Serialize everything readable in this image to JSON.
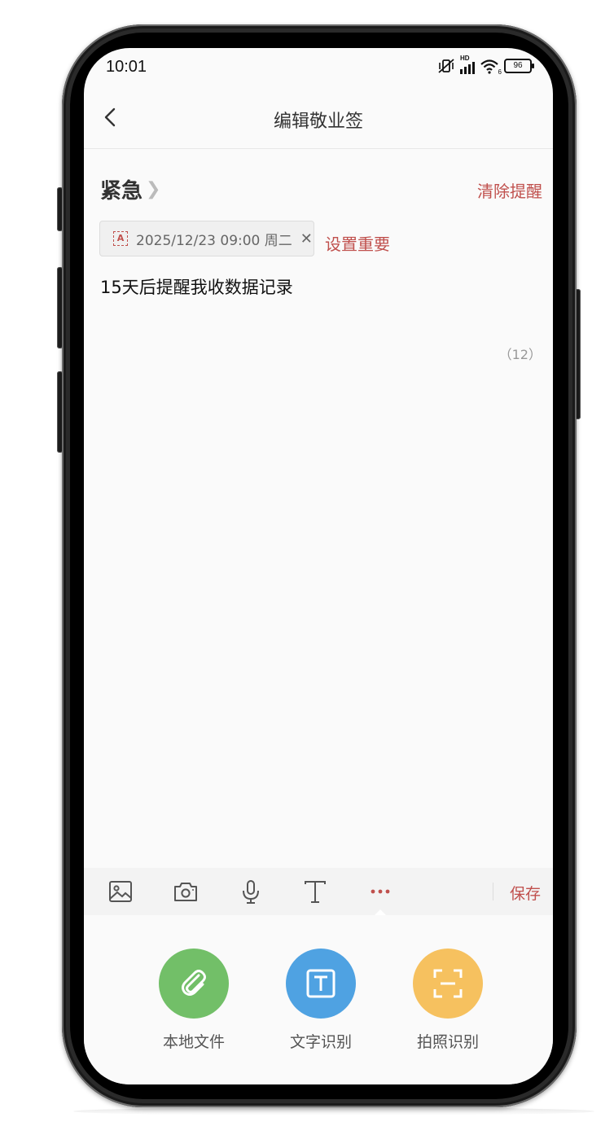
{
  "status_bar": {
    "time": "10:01",
    "network_label": "HD",
    "signal_strength": "6",
    "battery_level": "96"
  },
  "nav": {
    "title": "编辑敬业签"
  },
  "note": {
    "category": "紧急",
    "clear_reminder": "清除提醒",
    "reminder_chip": {
      "icon_text": "A",
      "datetime": "2025/12/23 09:00 周二"
    },
    "set_important": "设置重要",
    "content": "15天后提醒我收数据记录",
    "char_count": "（12）"
  },
  "toolbar": {
    "icons": [
      "image-icon",
      "camera-icon",
      "microphone-icon",
      "text-format-icon",
      "more-icon"
    ],
    "save_label": "保存"
  },
  "more_panel": {
    "actions": [
      {
        "label": "本地文件",
        "icon": "paperclip-icon",
        "color": "#72bf68"
      },
      {
        "label": "文字识别",
        "icon": "text-recognition-icon",
        "color": "#4fa2e2"
      },
      {
        "label": "拍照识别",
        "icon": "scan-icon",
        "color": "#f6c15f"
      }
    ]
  },
  "colors": {
    "accent": "#c0504d",
    "text": "#111111",
    "background": "#fafafa"
  }
}
